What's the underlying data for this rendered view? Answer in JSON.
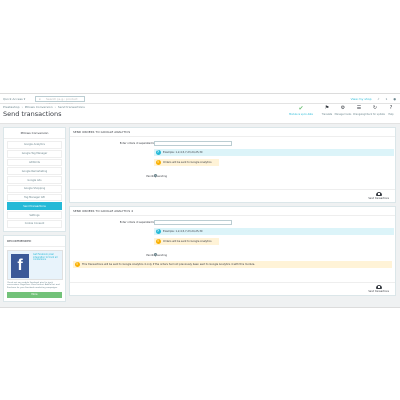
{
  "topbar": {
    "quick_access": "Quick Access",
    "search_placeholder": "Search (e.g.: product reference, custom",
    "view_shop": "View my shop",
    "notifications_count": "1"
  },
  "header": {
    "breadcrumbs": [
      "Prestashop",
      "Pillows Conversion",
      "Send transactions"
    ],
    "title": "Send transactions",
    "toolbar": [
      {
        "icon": "check-icon",
        "label": "Module is up-to-date",
        "style": "green"
      },
      {
        "icon": "translate-icon",
        "label": "Translate"
      },
      {
        "icon": "gear-icon",
        "label": "Manage hooks"
      },
      {
        "icon": "changelog-icon",
        "label": "Changelog"
      },
      {
        "icon": "refresh-icon",
        "label": "Check for update"
      },
      {
        "icon": "help-icon",
        "label": "Help"
      }
    ]
  },
  "sidebar": {
    "menu_title": "Pillows Conversion",
    "menu_items": [
      "Google Analytics",
      "Google Tag Manager",
      "AdWords",
      "Google Remarketing",
      "Google Ads",
      "Google Shopping",
      "Tag Manager API",
      "Send transactions",
      "Settings",
      "Cookie Consent"
    ],
    "active_index": 7,
    "promo_title": "RECOMMENDED",
    "promo_link": "Get Facebook pixel integration to track all conversions",
    "promo_desc": "Check out our module Facebook pixel to track conversions, PageView, ViewContent, AddToCart and Purchase for your Facebook marketing campaigns.",
    "promo_button": "More"
  },
  "sections": [
    {
      "title": "SEND ORDERS TO GOOGLE ANALYTICS",
      "field_label": "Enter orders id separated by commas",
      "info_text": "Example: 1,2,4,5,7,23,24,25,30",
      "warn_text": "Orders will be sent to Google Analytics",
      "pending_label": "Pending sending",
      "send_label": "Send transactions"
    },
    {
      "title": "SEND ORDERS TO GOOGLE ANALYTICS 4",
      "field_label": "Enter orders id separated by commas",
      "info_text": "Example: 1,2,4,5,7,23,24,25,30",
      "warn_text": "Orders will be sent to Google Analytics",
      "wide_warn_text": "This transactions will be sent to Google Analytics 4 only if the orders had not previously been sent to Google Analytics 4 with this module.",
      "pending_label": "Pending sending",
      "send_label": "Send transactions"
    }
  ]
}
